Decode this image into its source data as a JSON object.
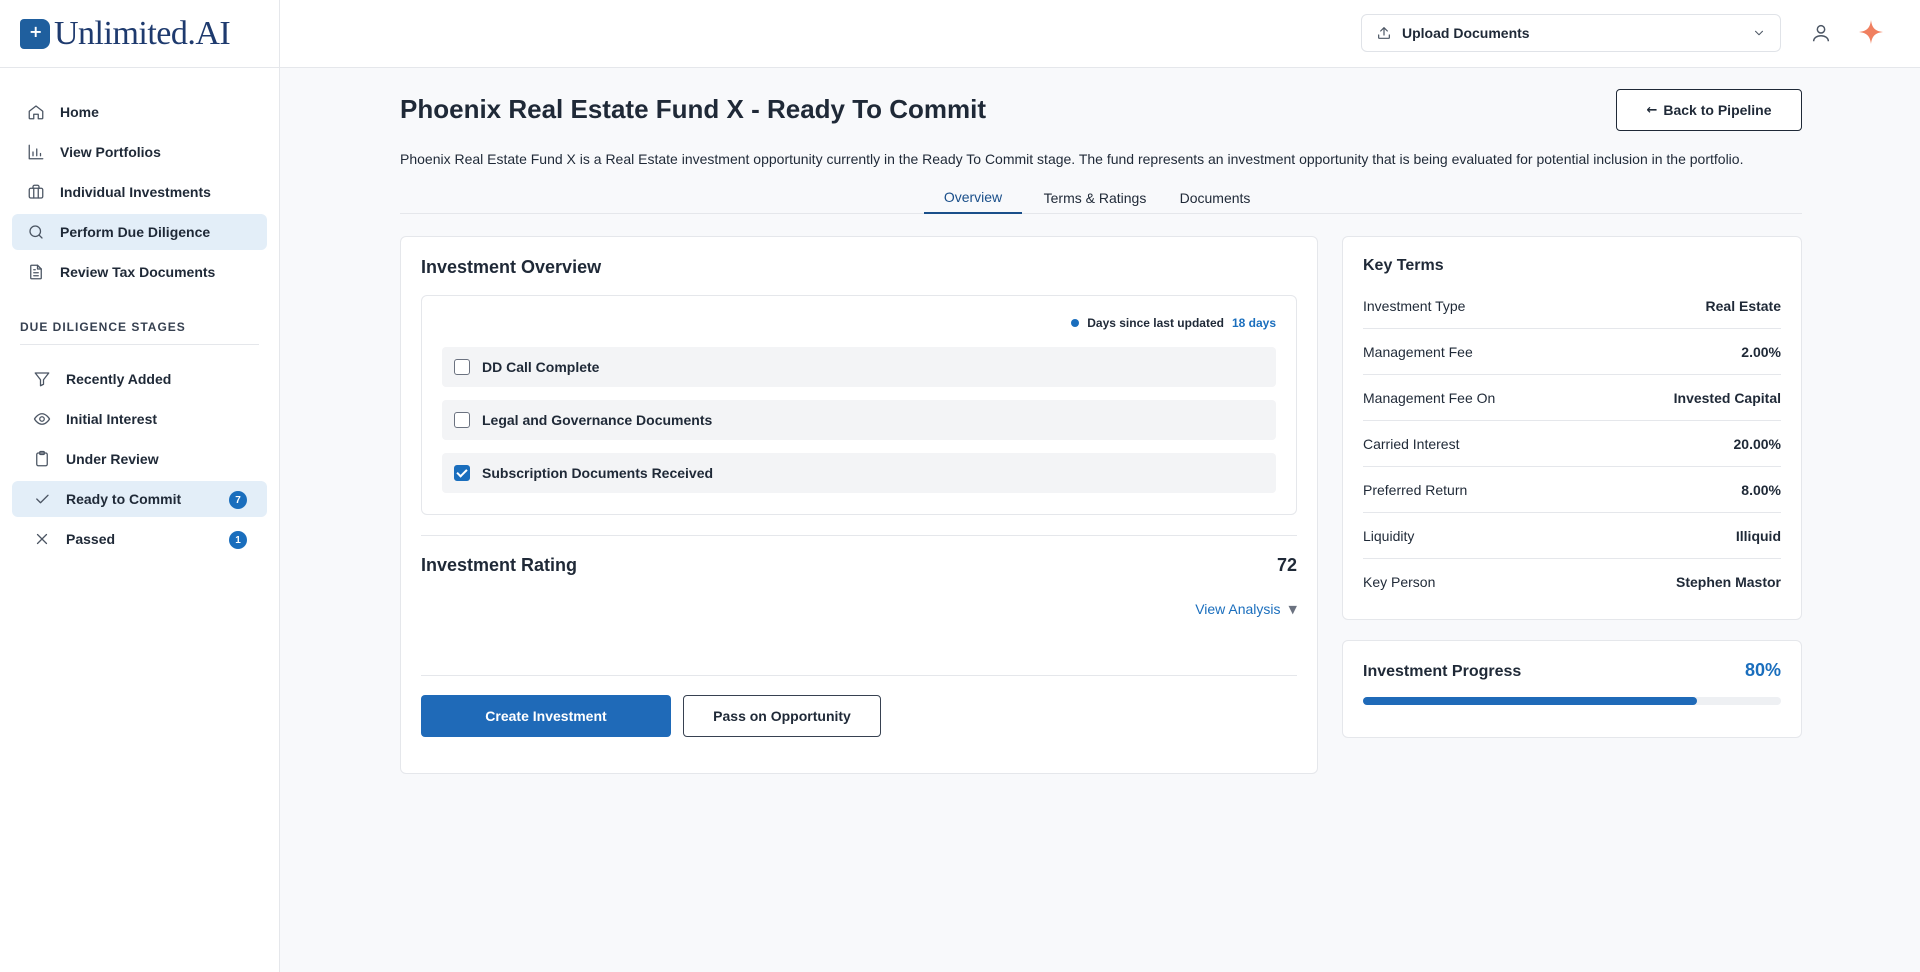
{
  "app": {
    "logo_text": "Unlimited.AI"
  },
  "sidebar": {
    "nav": [
      {
        "label": "Home",
        "icon": "home-icon"
      },
      {
        "label": "View Portfolios",
        "icon": "bar-chart-icon"
      },
      {
        "label": "Individual Investments",
        "icon": "briefcase-icon"
      },
      {
        "label": "Perform Due Diligence",
        "icon": "search-icon",
        "active": true
      },
      {
        "label": "Review Tax Documents",
        "icon": "document-icon"
      }
    ],
    "stages_title": "DUE DILIGENCE STAGES",
    "stages": [
      {
        "label": "Recently Added",
        "icon": "filter-icon"
      },
      {
        "label": "Initial Interest",
        "icon": "eye-icon"
      },
      {
        "label": "Under Review",
        "icon": "clipboard-icon"
      },
      {
        "label": "Ready to Commit",
        "icon": "check-icon",
        "count": "7",
        "active": true
      },
      {
        "label": "Passed",
        "icon": "x-icon",
        "count": "1"
      }
    ]
  },
  "topbar": {
    "upload_label": "Upload Documents"
  },
  "main": {
    "title": "Phoenix Real Estate Fund X - Ready To Commit",
    "back_label": "Back to Pipeline",
    "description": "Phoenix Real Estate Fund X is a Real Estate investment opportunity currently in the Ready To Commit stage. The fund represents an investment opportunity that is being evaluated for potential inclusion in the portfolio.",
    "tabs": [
      {
        "label": "Overview",
        "active": true
      },
      {
        "label": "Terms & Ratings"
      },
      {
        "label": "Documents"
      }
    ]
  },
  "overview": {
    "title": "Investment Overview",
    "updated_label": "Days since last updated",
    "updated_value": "18 days",
    "checklist": [
      {
        "label": "DD Call Complete",
        "checked": false
      },
      {
        "label": "Legal and Governance Documents",
        "checked": false
      },
      {
        "label": "Subscription Documents Received",
        "checked": true
      }
    ],
    "rating_label": "Investment Rating",
    "rating_value": "72",
    "view_analysis": "View Analysis",
    "create_label": "Create Investment",
    "pass_label": "Pass on Opportunity"
  },
  "key_terms": {
    "title": "Key Terms",
    "rows": [
      {
        "key": "Investment Type",
        "value": "Real Estate"
      },
      {
        "key": "Management Fee",
        "value": "2.00%"
      },
      {
        "key": "Management Fee On",
        "value": "Invested Capital"
      },
      {
        "key": "Carried Interest",
        "value": "20.00%"
      },
      {
        "key": "Preferred Return",
        "value": "8.00%"
      },
      {
        "key": "Liquidity",
        "value": "Illiquid"
      },
      {
        "key": "Key Person",
        "value": "Stephen Mastor"
      }
    ]
  },
  "progress": {
    "title": "Investment Progress",
    "percent_label": "80%",
    "fraction": 0.8
  },
  "colors": {
    "accent": "#1a6ebd",
    "primary_button": "#1f6ab8",
    "active_nav": "#e3eef8",
    "spark": "#f08060"
  }
}
